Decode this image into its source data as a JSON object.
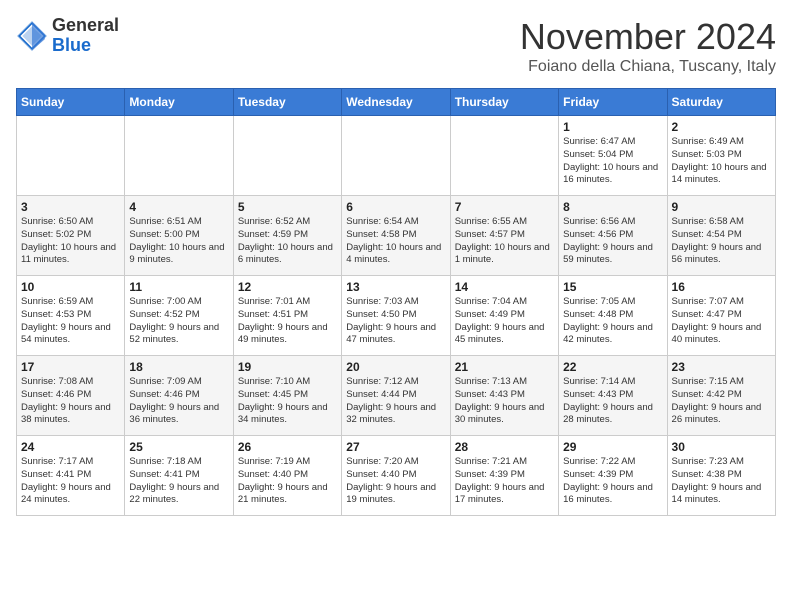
{
  "header": {
    "logo_general": "General",
    "logo_blue": "Blue",
    "month_title": "November 2024",
    "subtitle": "Foiano della Chiana, Tuscany, Italy"
  },
  "days_of_week": [
    "Sunday",
    "Monday",
    "Tuesday",
    "Wednesday",
    "Thursday",
    "Friday",
    "Saturday"
  ],
  "weeks": [
    [
      {
        "day": "",
        "info": ""
      },
      {
        "day": "",
        "info": ""
      },
      {
        "day": "",
        "info": ""
      },
      {
        "day": "",
        "info": ""
      },
      {
        "day": "",
        "info": ""
      },
      {
        "day": "1",
        "info": "Sunrise: 6:47 AM\nSunset: 5:04 PM\nDaylight: 10 hours and 16 minutes."
      },
      {
        "day": "2",
        "info": "Sunrise: 6:49 AM\nSunset: 5:03 PM\nDaylight: 10 hours and 14 minutes."
      }
    ],
    [
      {
        "day": "3",
        "info": "Sunrise: 6:50 AM\nSunset: 5:02 PM\nDaylight: 10 hours and 11 minutes."
      },
      {
        "day": "4",
        "info": "Sunrise: 6:51 AM\nSunset: 5:00 PM\nDaylight: 10 hours and 9 minutes."
      },
      {
        "day": "5",
        "info": "Sunrise: 6:52 AM\nSunset: 4:59 PM\nDaylight: 10 hours and 6 minutes."
      },
      {
        "day": "6",
        "info": "Sunrise: 6:54 AM\nSunset: 4:58 PM\nDaylight: 10 hours and 4 minutes."
      },
      {
        "day": "7",
        "info": "Sunrise: 6:55 AM\nSunset: 4:57 PM\nDaylight: 10 hours and 1 minute."
      },
      {
        "day": "8",
        "info": "Sunrise: 6:56 AM\nSunset: 4:56 PM\nDaylight: 9 hours and 59 minutes."
      },
      {
        "day": "9",
        "info": "Sunrise: 6:58 AM\nSunset: 4:54 PM\nDaylight: 9 hours and 56 minutes."
      }
    ],
    [
      {
        "day": "10",
        "info": "Sunrise: 6:59 AM\nSunset: 4:53 PM\nDaylight: 9 hours and 54 minutes."
      },
      {
        "day": "11",
        "info": "Sunrise: 7:00 AM\nSunset: 4:52 PM\nDaylight: 9 hours and 52 minutes."
      },
      {
        "day": "12",
        "info": "Sunrise: 7:01 AM\nSunset: 4:51 PM\nDaylight: 9 hours and 49 minutes."
      },
      {
        "day": "13",
        "info": "Sunrise: 7:03 AM\nSunset: 4:50 PM\nDaylight: 9 hours and 47 minutes."
      },
      {
        "day": "14",
        "info": "Sunrise: 7:04 AM\nSunset: 4:49 PM\nDaylight: 9 hours and 45 minutes."
      },
      {
        "day": "15",
        "info": "Sunrise: 7:05 AM\nSunset: 4:48 PM\nDaylight: 9 hours and 42 minutes."
      },
      {
        "day": "16",
        "info": "Sunrise: 7:07 AM\nSunset: 4:47 PM\nDaylight: 9 hours and 40 minutes."
      }
    ],
    [
      {
        "day": "17",
        "info": "Sunrise: 7:08 AM\nSunset: 4:46 PM\nDaylight: 9 hours and 38 minutes."
      },
      {
        "day": "18",
        "info": "Sunrise: 7:09 AM\nSunset: 4:46 PM\nDaylight: 9 hours and 36 minutes."
      },
      {
        "day": "19",
        "info": "Sunrise: 7:10 AM\nSunset: 4:45 PM\nDaylight: 9 hours and 34 minutes."
      },
      {
        "day": "20",
        "info": "Sunrise: 7:12 AM\nSunset: 4:44 PM\nDaylight: 9 hours and 32 minutes."
      },
      {
        "day": "21",
        "info": "Sunrise: 7:13 AM\nSunset: 4:43 PM\nDaylight: 9 hours and 30 minutes."
      },
      {
        "day": "22",
        "info": "Sunrise: 7:14 AM\nSunset: 4:43 PM\nDaylight: 9 hours and 28 minutes."
      },
      {
        "day": "23",
        "info": "Sunrise: 7:15 AM\nSunset: 4:42 PM\nDaylight: 9 hours and 26 minutes."
      }
    ],
    [
      {
        "day": "24",
        "info": "Sunrise: 7:17 AM\nSunset: 4:41 PM\nDaylight: 9 hours and 24 minutes."
      },
      {
        "day": "25",
        "info": "Sunrise: 7:18 AM\nSunset: 4:41 PM\nDaylight: 9 hours and 22 minutes."
      },
      {
        "day": "26",
        "info": "Sunrise: 7:19 AM\nSunset: 4:40 PM\nDaylight: 9 hours and 21 minutes."
      },
      {
        "day": "27",
        "info": "Sunrise: 7:20 AM\nSunset: 4:40 PM\nDaylight: 9 hours and 19 minutes."
      },
      {
        "day": "28",
        "info": "Sunrise: 7:21 AM\nSunset: 4:39 PM\nDaylight: 9 hours and 17 minutes."
      },
      {
        "day": "29",
        "info": "Sunrise: 7:22 AM\nSunset: 4:39 PM\nDaylight: 9 hours and 16 minutes."
      },
      {
        "day": "30",
        "info": "Sunrise: 7:23 AM\nSunset: 4:38 PM\nDaylight: 9 hours and 14 minutes."
      }
    ]
  ]
}
